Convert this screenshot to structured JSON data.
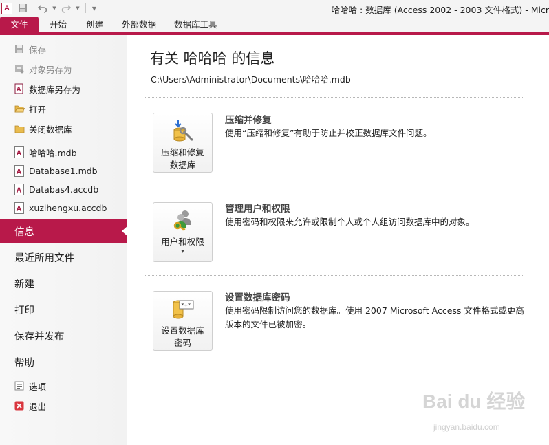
{
  "window": {
    "title": "哈哈哈 : 数据库 (Access 2002 - 2003 文件格式) - Micr",
    "app_icon_letter": "A"
  },
  "quick_access": {
    "icons": [
      "save-icon",
      "undo-icon",
      "redo-icon",
      "customize-qat-icon"
    ]
  },
  "ribbon": {
    "tabs": [
      {
        "label": "文件",
        "active": true
      },
      {
        "label": "开始"
      },
      {
        "label": "创建"
      },
      {
        "label": "外部数据"
      },
      {
        "label": "数据库工具"
      }
    ],
    "accent_color": "#b8194a"
  },
  "backstage": {
    "commands": [
      {
        "label": "保存",
        "icon": "save-icon",
        "enabled": false
      },
      {
        "label": "对象另存为",
        "icon": "save-object-as-icon",
        "enabled": false
      },
      {
        "label": "数据库另存为",
        "icon": "save-database-as-icon",
        "enabled": true
      },
      {
        "label": "打开",
        "icon": "open-folder-icon",
        "enabled": true
      },
      {
        "label": "关闭数据库",
        "icon": "close-database-icon",
        "enabled": true
      }
    ],
    "recent_files": [
      {
        "label": "哈哈哈.mdb"
      },
      {
        "label": "Database1.mdb"
      },
      {
        "label": "Databas4.accdb"
      },
      {
        "label": "xuzihengxu.accdb"
      }
    ],
    "sections": [
      {
        "label": "信息",
        "selected": true
      },
      {
        "label": "最近所用文件"
      },
      {
        "label": "新建"
      },
      {
        "label": "打印"
      },
      {
        "label": "保存并发布"
      },
      {
        "label": "帮助"
      }
    ],
    "bottom": [
      {
        "label": "选项",
        "icon": "options-icon"
      },
      {
        "label": "退出",
        "icon": "exit-icon"
      }
    ]
  },
  "info": {
    "title": "有关 哈哈哈 的信息",
    "path": "C:\\Users\\Administrator\\Documents\\哈哈哈.mdb",
    "features": [
      {
        "button_label": "压缩和修复\n数据库",
        "icon": "compact-repair-icon",
        "title": "压缩并修复",
        "description": "使用“压缩和修复”有助于防止并校正数据库文件问题。",
        "dropdown": false
      },
      {
        "button_label": "用户和权限",
        "icon": "users-permissions-icon",
        "title": "管理用户和权限",
        "description": "使用密码和权限来允许或限制个人或个人组访问数据库中的对象。",
        "dropdown": true
      },
      {
        "button_label": "设置数据库\n密码",
        "icon": "database-password-icon",
        "title": "设置数据库密码",
        "description": "使用密码限制访问您的数据库。使用 2007 Microsoft Access 文件格式或更高版本的文件已被加密。",
        "dropdown": false
      }
    ]
  },
  "watermark": {
    "brand": "Bai du 经验",
    "url": "jingyan.baidu.com"
  }
}
